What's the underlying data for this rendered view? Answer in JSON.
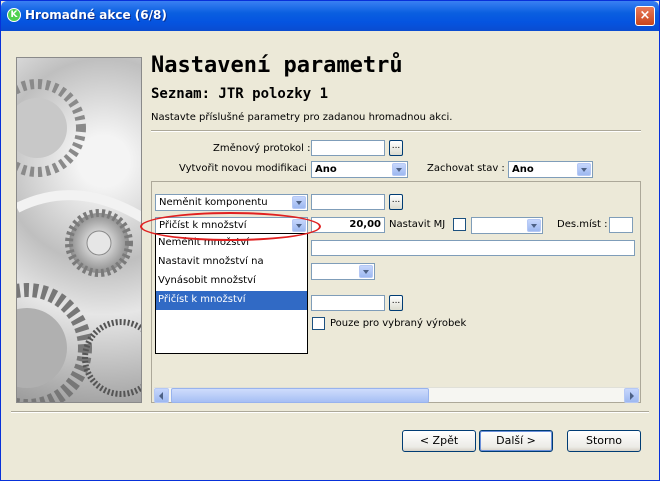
{
  "window": {
    "title": "Hromadné akce (6/8)"
  },
  "header": {
    "title": "Nastavení parametrů",
    "subtitle": "Seznam: JTR polozky 1",
    "description": "Nastavte příslušné parametry pro zadanou hromadnou akci."
  },
  "form": {
    "zmenovy_protokol_label": "Změnový protokol :",
    "zmenovy_protokol_value": "",
    "vytvorit_label": "Vytvořit novou modifikaci :",
    "vytvorit_value": "Ano",
    "zachovat_label": "Zachovat stav :",
    "zachovat_value": "Ano"
  },
  "rows": {
    "row1_combo": "Neměnit komponentu",
    "row1_value": "",
    "row2_combo": "Přičíst k množství",
    "row2_value": "20,00",
    "nastavit_mj_label": "Nastavit MJ",
    "des_mist_label": "Des.míst :",
    "des_mist_value": "",
    "pouze_label": "Pouze pro vybraný výrobek"
  },
  "dropdown": {
    "items": [
      "Neměnit množství",
      "Nastavit množství na",
      "Vynásobit množství",
      "Přičíst k množství"
    ],
    "selected_index": 3
  },
  "buttons": {
    "back": "< Zpět",
    "next": "Další >",
    "cancel": "Storno"
  },
  "icons": {
    "close": "×",
    "app": "K",
    "dots": "..."
  }
}
